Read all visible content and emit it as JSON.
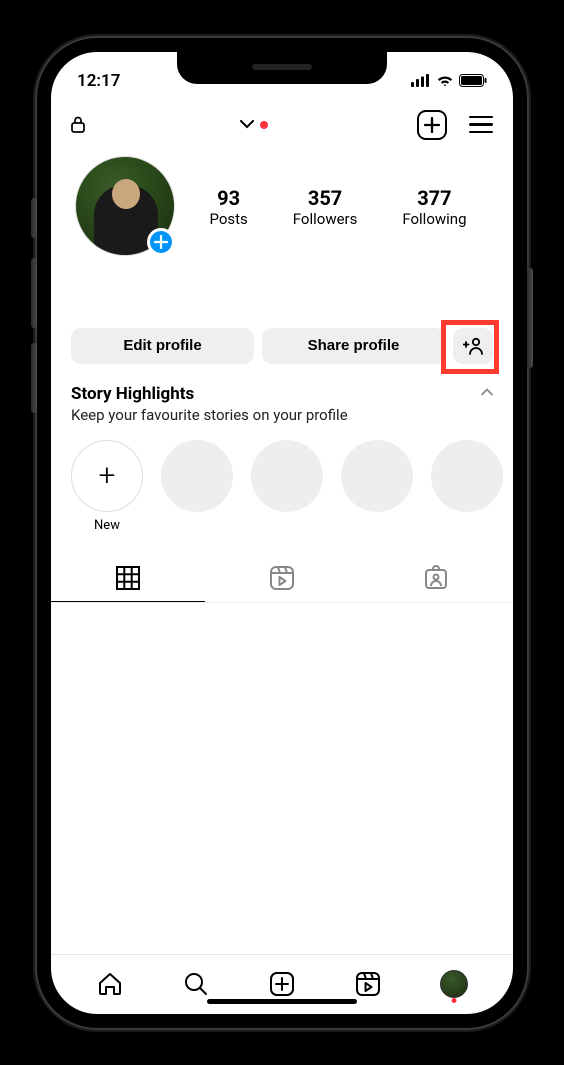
{
  "status": {
    "time": "12:17"
  },
  "header": {
    "username_display": ""
  },
  "stats": {
    "posts": {
      "value": "93",
      "label": "Posts"
    },
    "followers": {
      "value": "357",
      "label": "Followers"
    },
    "following": {
      "value": "377",
      "label": "Following"
    }
  },
  "buttons": {
    "edit_profile": "Edit profile",
    "share_profile": "Share profile"
  },
  "highlights": {
    "title": "Story Highlights",
    "subtitle": "Keep your favourite stories on your profile",
    "new_label": "New"
  }
}
